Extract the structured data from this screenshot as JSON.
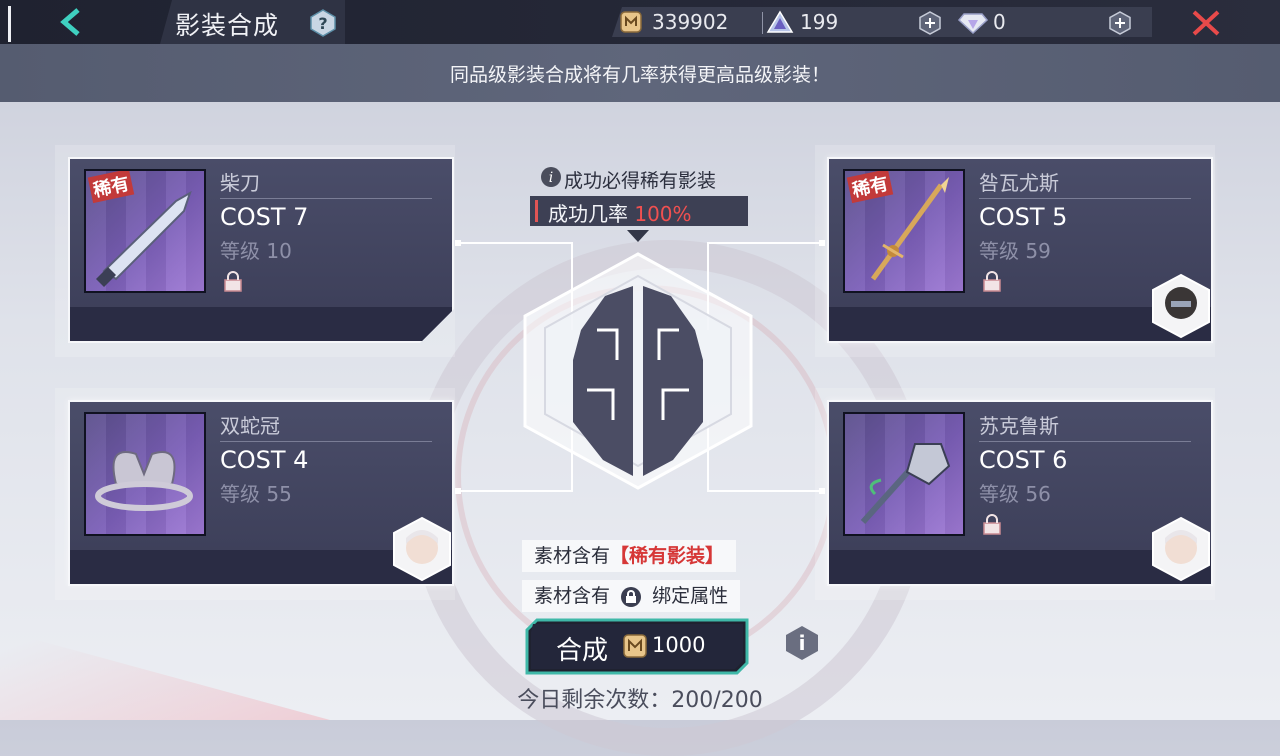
{
  "header": {
    "title": "影装合成",
    "coins": "339902",
    "crystals": "199",
    "gems": "0"
  },
  "info_banner": "同品级影装合成将有几率获得更高品级影装！",
  "center": {
    "notice": "成功必得稀有影装",
    "rate_label": "成功几率",
    "rate_value": "100%"
  },
  "items": [
    {
      "name": "柴刀",
      "cost": "COST 7",
      "level": "等级 10",
      "rare_tag": "稀有"
    },
    {
      "name": "咎瓦尤斯",
      "cost": "COST 5",
      "level": "等级 59",
      "rare_tag": "稀有"
    },
    {
      "name": "双蛇冠",
      "cost": "COST 4",
      "level": "等级 55"
    },
    {
      "name": "苏克鲁斯",
      "cost": "COST 6",
      "level": "等级 56"
    }
  ],
  "tags": {
    "material_prefix": "素材含有",
    "rare_equip": "【稀有影装】",
    "bind_attr": "绑定属性"
  },
  "craft": {
    "label": "合成",
    "cost": "1000"
  },
  "remaining": "今日剩余次数：200/200",
  "colors": {
    "accent_red": "#f05050",
    "panel_bg": "#3b3d57",
    "topbar_bg": "#1f2230",
    "craft_border": "#3fb8a8"
  }
}
